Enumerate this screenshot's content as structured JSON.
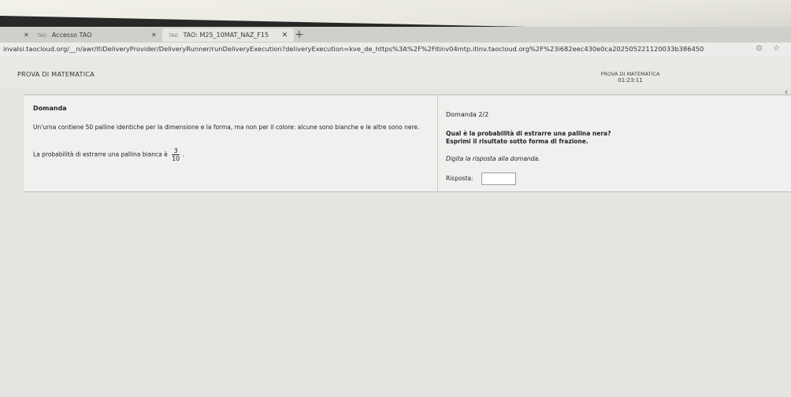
{
  "browser": {
    "tabs": [
      {
        "title": "Accesso TAO",
        "favicon": "tao"
      },
      {
        "title": "TAO: M25_10MAT_NAZ_F15",
        "favicon": "tao"
      }
    ],
    "url": "invalsi.taocloud.org/__n/awr/ltiDeliveryProvider/DeliveryRunner/runDeliveryExecution?deliveryExecution=kve_de_https%3A%2F%2Fitinv04mtp.itinv.taocloud.org%2F%23i682eec430e0ca202505221120033b386450"
  },
  "header": {
    "brand": "PROVA DI MATEMATICA",
    "test_name": "PROVA DI MATEMATICA",
    "timer": "01:23:11"
  },
  "question": {
    "title": "Domanda",
    "stem": "Un'urna contiene 50 palline identiche per la dimensione e la forma, ma non per il colore: alcune sono bianche e le altre sono nere.",
    "probability_text": "La probabilità di estrarre una pallina bianca è",
    "fraction": {
      "numerator": "3",
      "denominator": "10"
    },
    "period": "."
  },
  "answer_panel": {
    "counter": "Domanda 2/2",
    "question": "Qual è la probabilità di estrarre una pallina nera?",
    "instruction": "Esprimi il risultato sotto forma di frazione.",
    "hint": "Digita la risposta alla domanda.",
    "label": "Risposta:",
    "value": ""
  }
}
